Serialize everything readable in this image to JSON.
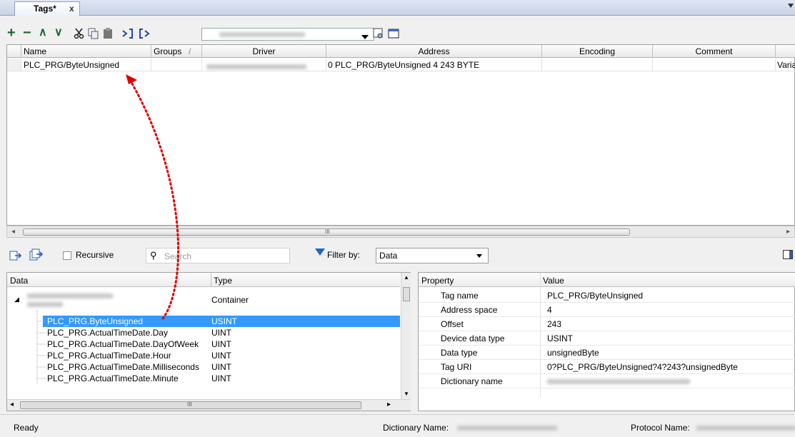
{
  "tab": {
    "title": "Tags*",
    "close": "x"
  },
  "toolbar": {
    "add": "+",
    "remove": "−",
    "up": "∧",
    "down": "∨",
    "cut_icon": "scissors-icon",
    "copy_icon": "copy-icon",
    "paste_icon": "paste-icon",
    "import_icon": "import-icon",
    "export_icon": "export-icon",
    "dropdown_icon": "chevron-down-icon",
    "config_icon": "settings-icon",
    "window_icon": "window-icon"
  },
  "grid": {
    "columns": [
      "Name",
      "Groups",
      "Driver",
      "Address",
      "Encoding",
      "Comment"
    ],
    "groups_sort": "/",
    "rows": [
      {
        "name": "PLC_PRG/ByteUnsigned",
        "groups": "",
        "address": "0 PLC_PRG/ByteUnsigned 4 243 BYTE",
        "encoding": "",
        "comment": "",
        "extra": "Varial"
      }
    ],
    "scroll_grip": "III"
  },
  "lower_toolbar": {
    "recursive_label": "Recursive",
    "search_placeholder": "Search",
    "filter_label": "Filter by:",
    "filter_value": "Data"
  },
  "data_tree": {
    "columns": [
      "Data",
      "Type"
    ],
    "container_type": "Container",
    "rows": [
      {
        "name": "PLC_PRG.ByteUnsigned",
        "type": "USINT",
        "selected": true
      },
      {
        "name": "PLC_PRG.ActualTimeDate.Day",
        "type": "UINT"
      },
      {
        "name": "PLC_PRG.ActualTimeDate.DayOfWeek",
        "type": "UINT"
      },
      {
        "name": "PLC_PRG.ActualTimeDate.Hour",
        "type": "UINT"
      },
      {
        "name": "PLC_PRG.ActualTimeDate.Milliseconds",
        "type": "UINT"
      },
      {
        "name": "PLC_PRG.ActualTimeDate.Minute",
        "type": "UINT"
      }
    ],
    "scroll_grip": "III"
  },
  "properties": {
    "columns": [
      "Property",
      "Value"
    ],
    "rows": [
      {
        "key": "Tag name",
        "value": "PLC_PRG/ByteUnsigned"
      },
      {
        "key": "Address space",
        "value": "4"
      },
      {
        "key": "Offset",
        "value": "243"
      },
      {
        "key": "Device data type",
        "value": "USINT"
      },
      {
        "key": "Data type",
        "value": "unsignedByte"
      },
      {
        "key": "Tag URI",
        "value": "0?PLC_PRG/ByteUnsigned?4?243?unsignedByte"
      },
      {
        "key": "Dictionary name",
        "value": ""
      }
    ]
  },
  "status": {
    "ready": "Ready",
    "dictionary_label": "Dictionary Name:",
    "protocol_label": "Protocol Name:"
  },
  "colors": {
    "selection": "#3399ff",
    "annotation_arrow": "#e00000"
  }
}
